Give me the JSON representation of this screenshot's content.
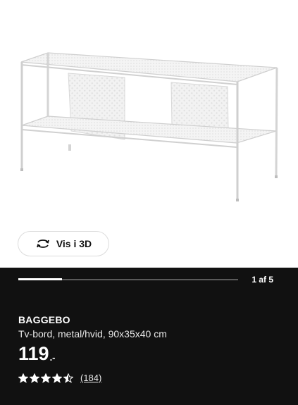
{
  "product_image": {
    "alt": "BAGGEBO tv-bord"
  },
  "view3d": {
    "label": "Vis i 3D",
    "icon": "rotate-3d-icon"
  },
  "carousel": {
    "counter": "1 af 5",
    "progress": 0.2
  },
  "product": {
    "name": "BAGGEBO",
    "description": "Tv-bord, metal/hvid, 90x35x40 cm",
    "price": "119",
    "price_suffix": ".-",
    "rating": 4.5,
    "review_count": "(184)"
  },
  "colors": {
    "panel_bg": "#111111",
    "text": "#ffffff",
    "furniture": "#f0f0f0",
    "furniture_edge": "#cfcfcf"
  }
}
